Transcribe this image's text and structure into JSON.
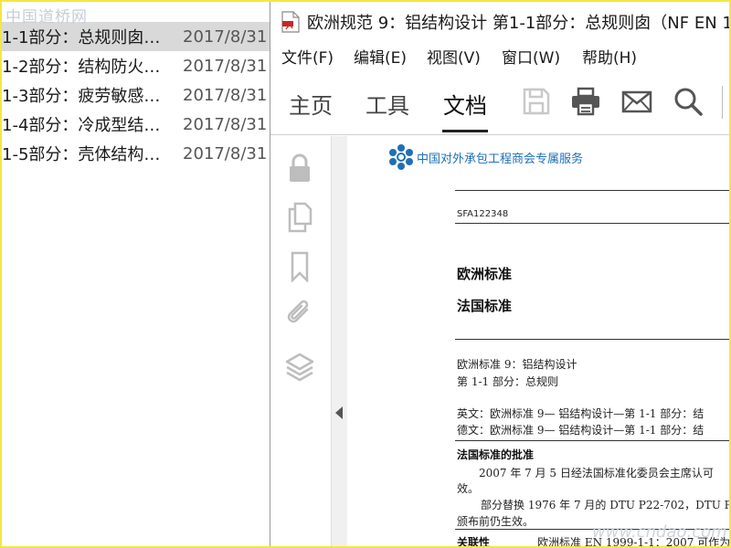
{
  "watermark_top": "中国道桥网",
  "watermark_bottom": "www.cndao.com",
  "files": [
    {
      "name": "1-1部分：总规则囱…",
      "date": "2017/8/31",
      "selected": true
    },
    {
      "name": "1-2部分：结构防火…",
      "date": "2017/8/31",
      "selected": false
    },
    {
      "name": "1-3部分：疲劳敏感…",
      "date": "2017/8/31",
      "selected": false
    },
    {
      "name": "1-4部分：冷成型结…",
      "date": "2017/8/31",
      "selected": false
    },
    {
      "name": "1-5部分：壳体结构…",
      "date": "2017/8/31",
      "selected": false
    }
  ],
  "window": {
    "title": "欧洲规范 9：铝结构设计 第1-1部分：总规则囱（NF EN 1"
  },
  "menu": {
    "file": "文件(F)",
    "edit": "编辑(E)",
    "view": "视图(V)",
    "window": "窗口(W)",
    "help": "帮助(H)"
  },
  "tabs": {
    "home": "主页",
    "tools": "工具",
    "document": "文档"
  },
  "toolbar_icons": [
    "save-icon",
    "print-icon",
    "mail-icon",
    "search-icon"
  ],
  "nav_icons": [
    "lock-icon",
    "copy-pages-icon",
    "bookmark-icon",
    "attachment-icon",
    "layers-icon"
  ],
  "document": {
    "logo_text": "中国对外承包工程商会专属服务",
    "code": "SFA122348",
    "heading1": "欧洲标准",
    "heading2": "法国标准",
    "line1": "欧洲标准 9：铝结构设计",
    "line2": "第 1-1 部分：总规则",
    "line3": "英文：欧洲标准 9— 铝结构设计—第 1-1 部分：结",
    "line4": "德文：欧洲标准 9— 铝结构设计—第 1-1 部分：结",
    "approval_title": "法国标准的批准",
    "approval_1": "2007 年 7 月 5 日经法国标准化委员会主席认可",
    "approval_2": "效。",
    "approval_3": "部分替换 1976 年 7 月的 DTU P22-702，DTU P2",
    "approval_4": "颁布前仍生效。",
    "relevance_label": "关联性",
    "relevance_text": "欧洲标准 EN 1999-1-1：2007 可作为"
  },
  "colors": {
    "accent_blue": "#1e6fb8",
    "frame_yellow": "#f5e642",
    "selected_row": "#d9d9d9"
  }
}
